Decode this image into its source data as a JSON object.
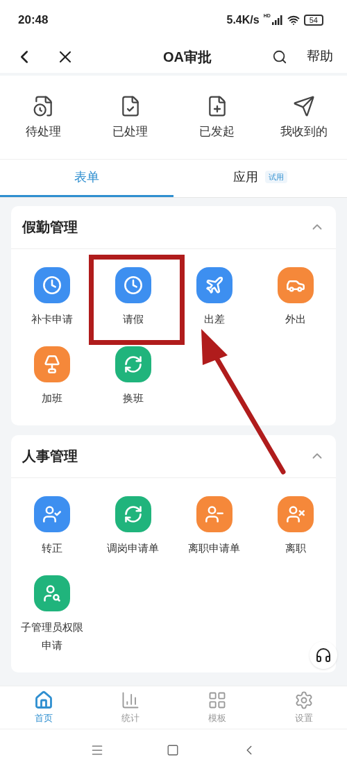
{
  "status_bar": {
    "time": "20:48",
    "speed": "5.4K/s",
    "network": "HD",
    "battery": "54"
  },
  "header": {
    "title": "OA审批",
    "help": "帮助"
  },
  "quick_actions": [
    {
      "label": "待处理"
    },
    {
      "label": "已处理"
    },
    {
      "label": "已发起"
    },
    {
      "label": "我收到的"
    }
  ],
  "tabs": [
    {
      "label": "表单",
      "selected": true
    },
    {
      "label": "应用",
      "selected": false,
      "badge": "试用"
    }
  ],
  "sections": [
    {
      "title": "假勤管理",
      "expanded": true,
      "items": [
        {
          "label": "补卡申请",
          "color": "#3d8ff0"
        },
        {
          "label": "请假",
          "color": "#3d8ff0",
          "highlighted": true
        },
        {
          "label": "出差",
          "color": "#3d8ff0"
        },
        {
          "label": "外出",
          "color": "#f5883a"
        },
        {
          "label": "加班",
          "color": "#f5883a"
        },
        {
          "label": "换班",
          "color": "#20b47c"
        }
      ]
    },
    {
      "title": "人事管理",
      "expanded": true,
      "items": [
        {
          "label": "转正",
          "color": "#3d8ff0"
        },
        {
          "label": "调岗申请单",
          "color": "#20b47c"
        },
        {
          "label": "离职申请单",
          "color": "#f5883a"
        },
        {
          "label": "离职",
          "color": "#f5883a"
        },
        {
          "label": "子管理员权限申请",
          "color": "#20b47c"
        }
      ]
    }
  ],
  "bottom_nav": [
    {
      "label": "首页",
      "selected": true
    },
    {
      "label": "统计",
      "selected": false
    },
    {
      "label": "模板",
      "selected": false
    },
    {
      "label": "设置",
      "selected": false
    }
  ]
}
